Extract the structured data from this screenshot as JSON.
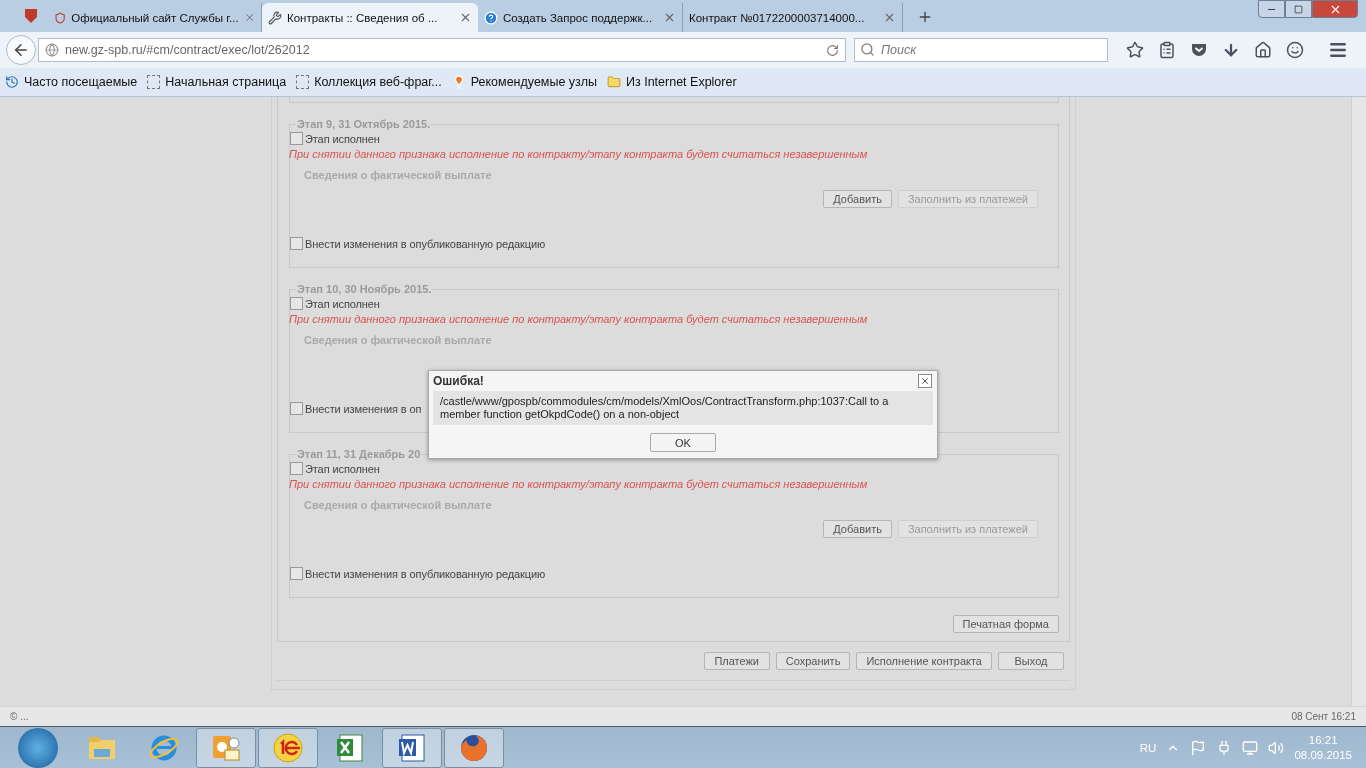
{
  "browser": {
    "tabs": [
      {
        "title": "Официальный сайт Службы г...",
        "kind": "emblem",
        "selected": false
      },
      {
        "title": "Контракты :: Сведения об ...",
        "kind": "hammer",
        "selected": true
      },
      {
        "title": "Создать Запрос поддержк...",
        "kind": "help",
        "selected": false
      },
      {
        "title": "Контракт №0172200003714000...",
        "kind": "plain",
        "selected": false
      }
    ],
    "address": "new.gz-spb.ru/#cm/contract/exec/lot/262012",
    "search": {
      "placeholder": "Поиск"
    },
    "bookmarks": [
      {
        "label": "Часто посещаемые",
        "kind": "recent"
      },
      {
        "label": "Начальная страница",
        "kind": "blank"
      },
      {
        "label": "Коллекция веб-фраг...",
        "kind": "blank"
      },
      {
        "label": "Рекомендуемые узлы",
        "kind": "bulb"
      },
      {
        "label": "Из Internet Explorer",
        "kind": "folder"
      }
    ]
  },
  "stages": [
    {
      "legend": "Этап 9, 31 Октябрь 2015.",
      "done_label": "Этап исполнен",
      "done_checked": false,
      "warning": "При снятии данного признака исполнение по контракту/этапу контракта будет считаться незавершенным",
      "payments_title": "Сведения о фактической выплате",
      "buttons": [
        {
          "label": "Добавить",
          "disabled": false
        },
        {
          "label": "Заполнить из платежей",
          "disabled": true
        }
      ],
      "publish_label": "Внести изменения в опубликованную редакцию",
      "publish_checked": false
    },
    {
      "legend": "Этап 10, 30 Ноябрь 2015.",
      "done_label": "Этап исполнен",
      "done_checked": false,
      "warning": "При снятии данного признака исполнение по контракту/этапу контракта будет считаться незавершенным",
      "payments_title": "Сведения о фактической выплате",
      "publish_label": "Внести изменения в оп",
      "publish_checked": false
    },
    {
      "legend": "Этап 11, 31 Декабрь 20",
      "done_label": "Этап исполнен",
      "done_checked": false,
      "warning": "При снятии данного признака исполнение по контракту/этапу контракта будет считаться незавершенным",
      "payments_title": "Сведения о фактической выплате",
      "buttons": [
        {
          "label": "Добавить",
          "disabled": false
        },
        {
          "label": "Заполнить из платежей",
          "disabled": true
        }
      ],
      "publish_label": "Внести изменения в опубликованную редакцию",
      "publish_checked": false
    }
  ],
  "print_button": "Печатная форма",
  "footer_buttons": [
    "Платежи",
    "Сохранить",
    "Исполнение контракта",
    "Выход"
  ],
  "dialog": {
    "title": "Ошибка!",
    "message": "/castle/www/gpospb/commodules/cm/models/XmlOos/ContractTransform.php:1037:Call to a member function getOkpdCode() on a non-object",
    "button": "OK"
  },
  "status_bar": {
    "left": "© ...",
    "right": "08 Сент 16:21"
  },
  "taskbar": {
    "apps": [
      {
        "kind": "explorer",
        "active": false
      },
      {
        "kind": "ie",
        "active": false
      },
      {
        "kind": "outlook",
        "active": true
      },
      {
        "kind": "onec",
        "active": true
      },
      {
        "kind": "excel",
        "active": false
      },
      {
        "kind": "word",
        "active": true
      },
      {
        "kind": "firefox",
        "active": true
      }
    ],
    "language": "RU",
    "time": "16:21",
    "date": "08.09.2015"
  }
}
